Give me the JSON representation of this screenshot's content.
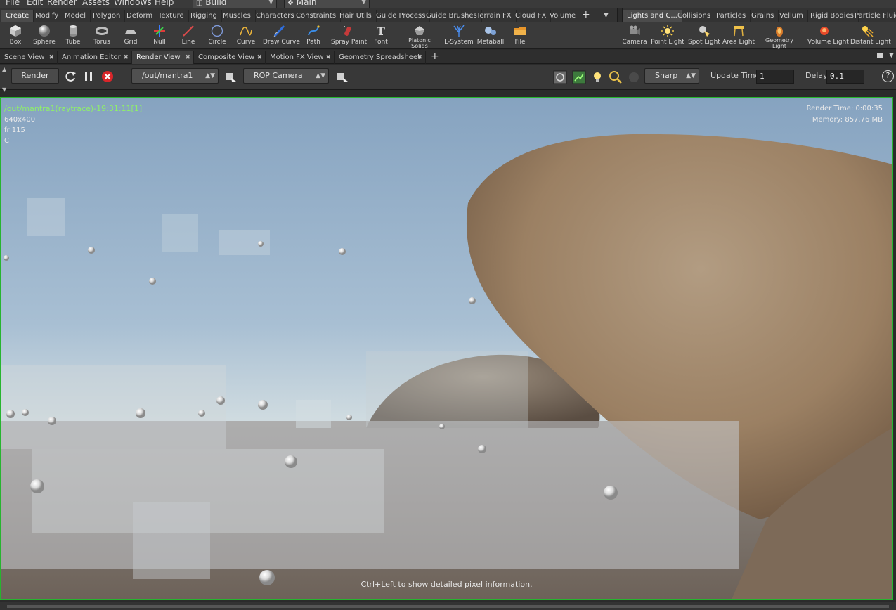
{
  "menubar": {
    "items": [
      "File",
      "Edit",
      "Render",
      "Assets",
      "Windows",
      "Help"
    ],
    "desktop": "Build",
    "network": "Main"
  },
  "shelf_tabs_left": [
    "Create",
    "Modify",
    "Model",
    "Polygon",
    "Deform",
    "Texture",
    "Rigging",
    "Muscles",
    "Characters",
    "Constraints",
    "Hair Utils",
    "Guide Process",
    "Guide Brushes",
    "Terrain FX",
    "Cloud FX",
    "Volume"
  ],
  "shelf_tabs_right": [
    "Lights and C...",
    "Collisions",
    "Particles",
    "Grains",
    "Vellum",
    "Rigid Bodies",
    "Particle Fluids"
  ],
  "tools_left": [
    {
      "label": "Box",
      "icon": "box-icon"
    },
    {
      "label": "Sphere",
      "icon": "sphere-icon"
    },
    {
      "label": "Tube",
      "icon": "tube-icon"
    },
    {
      "label": "Torus",
      "icon": "torus-icon"
    },
    {
      "label": "Grid",
      "icon": "grid-icon"
    },
    {
      "label": "Null",
      "icon": "null-icon"
    },
    {
      "label": "Line",
      "icon": "line-icon"
    },
    {
      "label": "Circle",
      "icon": "circle-icon"
    },
    {
      "label": "Curve",
      "icon": "curve-icon"
    },
    {
      "label": "Draw Curve",
      "icon": "draw-curve-icon"
    },
    {
      "label": "Path",
      "icon": "path-icon"
    },
    {
      "label": "Spray Paint",
      "icon": "spray-paint-icon"
    },
    {
      "label": "Font",
      "icon": "font-icon"
    },
    {
      "label": "Platonic Solids",
      "icon": "platonic-solids-icon"
    },
    {
      "label": "L-System",
      "icon": "l-system-icon"
    },
    {
      "label": "Metaball",
      "icon": "metaball-icon"
    },
    {
      "label": "File",
      "icon": "file-icon"
    }
  ],
  "tools_right": [
    {
      "label": "Camera",
      "icon": "camera-icon"
    },
    {
      "label": "Point Light",
      "icon": "point-light-icon"
    },
    {
      "label": "Spot Light",
      "icon": "spot-light-icon"
    },
    {
      "label": "Area Light",
      "icon": "area-light-icon"
    },
    {
      "label": "Geometry Light",
      "icon": "geometry-light-icon"
    },
    {
      "label": "Volume Light",
      "icon": "volume-light-icon"
    },
    {
      "label": "Distant Light",
      "icon": "distant-light-icon"
    }
  ],
  "pane_tabs": [
    "Scene View",
    "Animation Editor",
    "Render View",
    "Composite View",
    "Motion FX View",
    "Geometry Spreadsheet"
  ],
  "render_toolbar": {
    "render_label": "Render",
    "rop_path": "/out/mantra1",
    "camera": "ROP Camera",
    "filter": "Sharp",
    "update_time_label": "Update Time",
    "update_time_value": "1",
    "delay_label": "Delay",
    "delay_value": "0.1",
    "help": "?"
  },
  "viewport": {
    "title": "/out/mantra1(raytrace)-19:31:11[1]",
    "resolution": "640x400",
    "frame": "fr 115",
    "channel": "C",
    "render_time": "Render Time: 0:00:35",
    "memory": "Memory:   857.76 MB",
    "hint": "Ctrl+Left to show detailed pixel information."
  },
  "colors": {
    "accent_border": "#27b52f",
    "title_text": "#8fef6a",
    "stop_button": "#d8262a"
  }
}
